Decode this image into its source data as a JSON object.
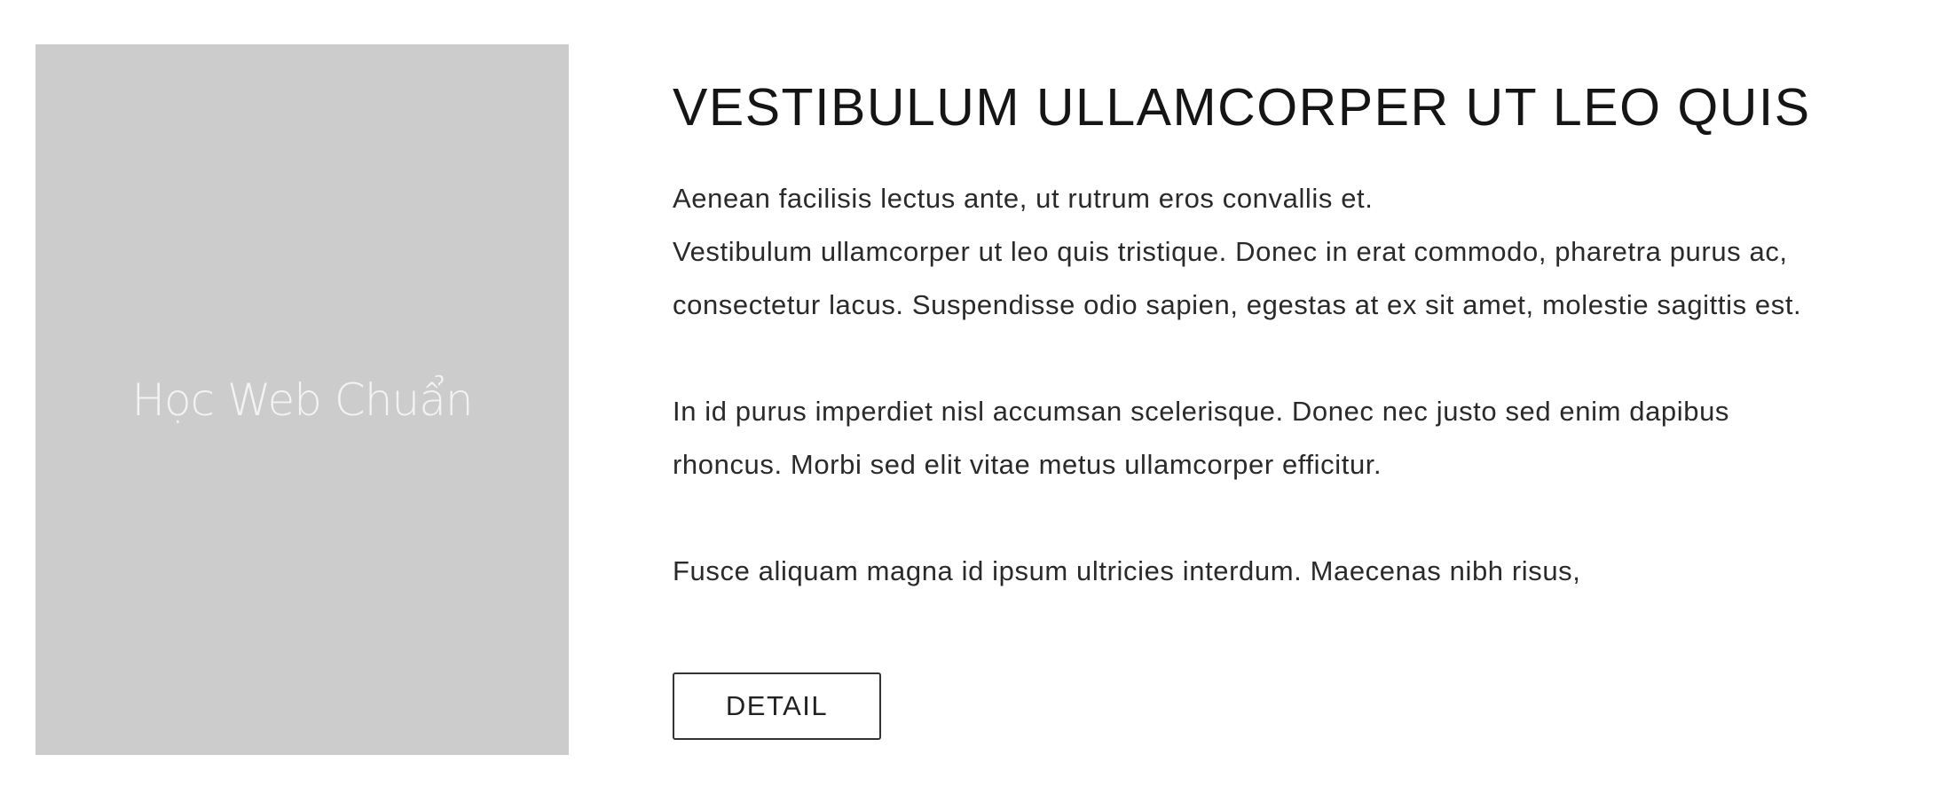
{
  "image": {
    "placeholder_text": "Học Web Chuẩn",
    "background_color": "#cccccc"
  },
  "article": {
    "title": "VESTIBULUM ULLAMCORPER UT LEO QUIS",
    "paragraphs": [
      {
        "lines": [
          "Aenean facilisis lectus ante, ut rutrum eros convallis et.",
          "Vestibulum ullamcorper ut leo quis tristique. Donec in erat commodo, pharetra purus ac,",
          "consectetur lacus. Suspendisse odio sapien, egestas at ex sit amet, molestie sagittis est."
        ]
      },
      {
        "lines": [
          "In id purus imperdiet nisl accumsan scelerisque. Donec nec justo sed enim dapibus",
          "rhoncus. Morbi sed elit vitae metus ullamcorper efficitur."
        ]
      },
      {
        "lines": [
          "Fusce aliquam magna id ipsum ultricies interdum. Maecenas nibh risus,"
        ]
      }
    ],
    "button_label": "DETAIL"
  }
}
